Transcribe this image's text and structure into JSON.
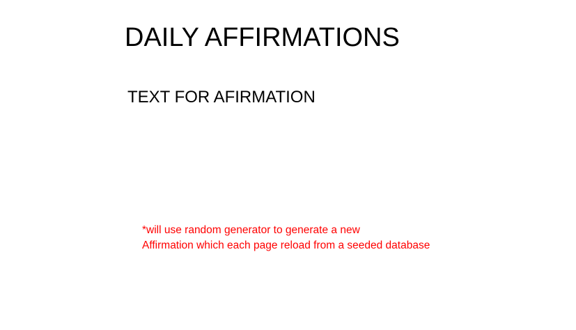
{
  "slide": {
    "title": "DAILY AFFIRMATIONS",
    "subtitle": "TEXT FOR AFIRMATION",
    "note": {
      "line1": "*will use random generator to generate a new",
      "line2": "Affirmation which each page reload from a seeded database",
      "color": "#ff0000"
    }
  }
}
